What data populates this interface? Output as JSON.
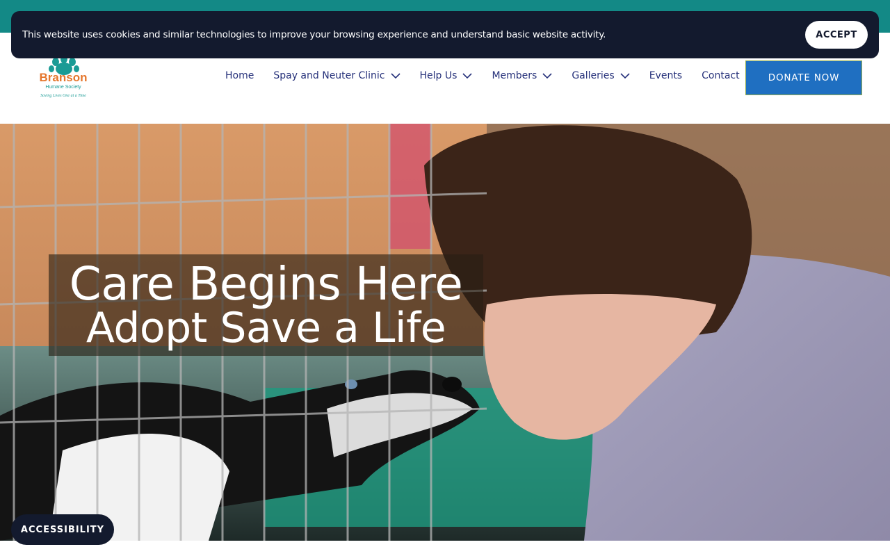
{
  "cookie_banner": {
    "text": "This website uses cookies and similar technologies to improve your browsing experience and understand basic website activity.",
    "accept_label": "ACCEPT"
  },
  "logo": {
    "name": "Branson",
    "line2": "Humane Society",
    "tagline": "Saving Lives One at a Time",
    "icon": "paw-icon"
  },
  "nav": {
    "items": [
      {
        "label": "Home",
        "has_dropdown": false
      },
      {
        "label": "Spay and Neuter Clinic",
        "has_dropdown": true
      },
      {
        "label": "Help Us",
        "has_dropdown": true
      },
      {
        "label": "Members",
        "has_dropdown": true
      },
      {
        "label": "Galleries",
        "has_dropdown": true
      },
      {
        "label": "Events",
        "has_dropdown": false
      },
      {
        "label": "Contact",
        "has_dropdown": false
      }
    ]
  },
  "donate_label": "DONATE NOW",
  "hero": {
    "line1": "Care Begins Here",
    "line2": "Adopt Save a Life"
  },
  "accessibility_label": "ACCESSIBILITY",
  "colors": {
    "topbar": "#138986",
    "banner_bg": "#131a2e",
    "nav_text": "#26317a",
    "donate_bg": "#1f6fc1",
    "logo_orange": "#e5762c",
    "logo_teal": "#1a9b95"
  }
}
